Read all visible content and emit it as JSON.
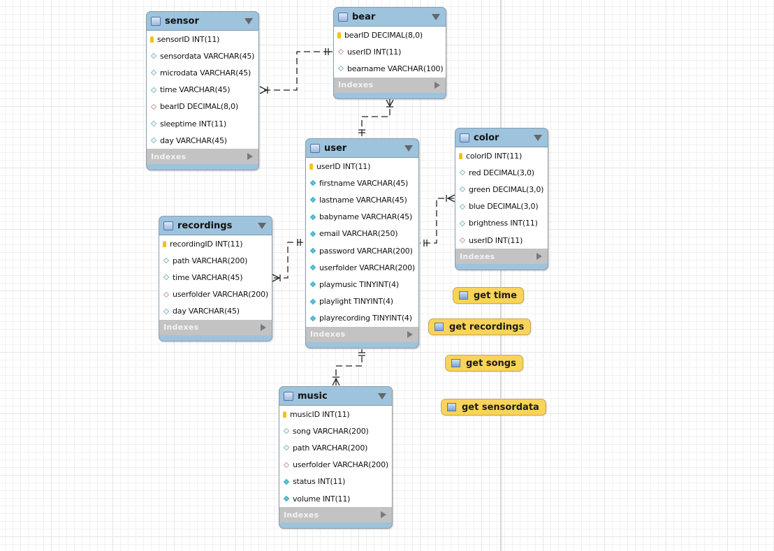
{
  "canvas": {
    "page_break_visible": true
  },
  "tables": {
    "sensor": {
      "name": "sensor",
      "columns": [
        {
          "text": "sensorID INT(11)",
          "kind": "pk"
        },
        {
          "text": "sensordata VARCHAR(45)",
          "kind": "col"
        },
        {
          "text": "microdata VARCHAR(45)",
          "kind": "col"
        },
        {
          "text": "time VARCHAR(45)",
          "kind": "col"
        },
        {
          "text": "bearID DECIMAL(8,0)",
          "kind": "fk"
        },
        {
          "text": "sleeptime INT(11)",
          "kind": "col"
        },
        {
          "text": "day VARCHAR(45)",
          "kind": "col"
        }
      ],
      "indexes_label": "Indexes"
    },
    "bear": {
      "name": "bear",
      "columns": [
        {
          "text": "bearID DECIMAL(8,0)",
          "kind": "pk"
        },
        {
          "text": "userID INT(11)",
          "kind": "fk"
        },
        {
          "text": "bearname VARCHAR(100)",
          "kind": "col"
        }
      ],
      "indexes_label": "Indexes"
    },
    "user": {
      "name": "user",
      "columns": [
        {
          "text": "userID INT(11)",
          "kind": "pk"
        },
        {
          "text": "firstname VARCHAR(45)",
          "kind": "nn"
        },
        {
          "text": "lastname VARCHAR(45)",
          "kind": "nn"
        },
        {
          "text": "babyname VARCHAR(45)",
          "kind": "nn"
        },
        {
          "text": "email VARCHAR(250)",
          "kind": "nn"
        },
        {
          "text": "password VARCHAR(200)",
          "kind": "nn"
        },
        {
          "text": "userfolder VARCHAR(200)",
          "kind": "nn"
        },
        {
          "text": "playmusic TINYINT(4)",
          "kind": "nn"
        },
        {
          "text": "playlight TINYINT(4)",
          "kind": "nn"
        },
        {
          "text": "playrecording TINYINT(4)",
          "kind": "nn"
        }
      ],
      "indexes_label": "Indexes"
    },
    "color": {
      "name": "color",
      "columns": [
        {
          "text": "colorID INT(11)",
          "kind": "pk"
        },
        {
          "text": "red DECIMAL(3,0)",
          "kind": "col"
        },
        {
          "text": "green DECIMAL(3,0)",
          "kind": "col"
        },
        {
          "text": "blue DECIMAL(3,0)",
          "kind": "col"
        },
        {
          "text": "brightness INT(11)",
          "kind": "col"
        },
        {
          "text": "userID INT(11)",
          "kind": "fk"
        }
      ],
      "indexes_label": "Indexes"
    },
    "recordings": {
      "name": "recordings",
      "columns": [
        {
          "text": "recordingID INT(11)",
          "kind": "pk"
        },
        {
          "text": "path VARCHAR(200)",
          "kind": "col"
        },
        {
          "text": "time VARCHAR(45)",
          "kind": "col"
        },
        {
          "text": "userfolder VARCHAR(200)",
          "kind": "fk"
        },
        {
          "text": "day VARCHAR(45)",
          "kind": "col"
        }
      ],
      "indexes_label": "Indexes"
    },
    "music": {
      "name": "music",
      "columns": [
        {
          "text": "musicID INT(11)",
          "kind": "pk"
        },
        {
          "text": "song VARCHAR(200)",
          "kind": "col"
        },
        {
          "text": "path VARCHAR(200)",
          "kind": "col"
        },
        {
          "text": "userfolder VARCHAR(200)",
          "kind": "fk"
        },
        {
          "text": "status INT(11)",
          "kind": "nn"
        },
        {
          "text": "volume INT(11)",
          "kind": "nn"
        }
      ],
      "indexes_label": "Indexes"
    }
  },
  "routines": [
    {
      "name": "get time"
    },
    {
      "name": "get recordings"
    },
    {
      "name": "get songs"
    },
    {
      "name": "get sensordata"
    }
  ],
  "relationships": [
    {
      "from": "sensor",
      "to": "bear",
      "type": "many-to-one"
    },
    {
      "from": "bear",
      "to": "user",
      "type": "many-to-one"
    },
    {
      "from": "recordings",
      "to": "user",
      "type": "many-to-one"
    },
    {
      "from": "color",
      "to": "user",
      "type": "many-to-one"
    },
    {
      "from": "music",
      "to": "user",
      "type": "many-to-one"
    }
  ],
  "colors": {
    "table_header": "#9ec3dd",
    "indexes_bar": "#c3c3c3",
    "routine_fill": "#f9d35a",
    "pk_key": "#f4c20d",
    "fk_diamond": "#cc9a9a",
    "nn_diamond": "#57c3d9"
  }
}
